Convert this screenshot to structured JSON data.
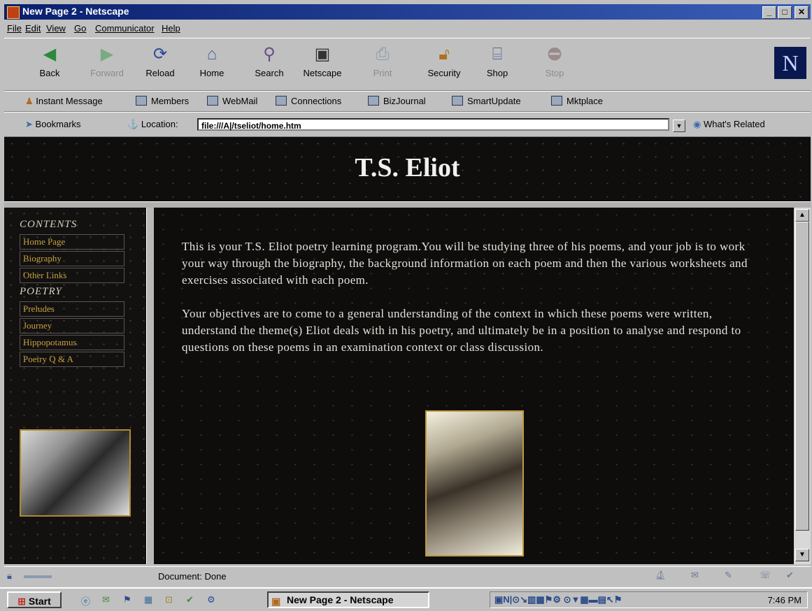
{
  "window": {
    "title": "New Page 2 - Netscape"
  },
  "menu": [
    "File",
    "Edit",
    "View",
    "Go",
    "Communicator",
    "Help"
  ],
  "nav_buttons": [
    {
      "label": "Back",
      "icon": "back-icon",
      "enabled": true
    },
    {
      "label": "Forward",
      "icon": "forward-icon",
      "enabled": false
    },
    {
      "label": "Reload",
      "icon": "reload-icon",
      "enabled": true
    },
    {
      "label": "Home",
      "icon": "home-icon",
      "enabled": true
    },
    {
      "label": "Search",
      "icon": "search-icon",
      "enabled": true
    },
    {
      "label": "Netscape",
      "icon": "netscape-icon",
      "enabled": true
    },
    {
      "label": "Print",
      "icon": "print-icon",
      "enabled": false
    },
    {
      "label": "Security",
      "icon": "lock-icon",
      "enabled": true
    },
    {
      "label": "Shop",
      "icon": "shop-icon",
      "enabled": true
    },
    {
      "label": "Stop",
      "icon": "stop-icon",
      "enabled": false
    }
  ],
  "personal_bar": [
    "Instant Message",
    "Members",
    "WebMail",
    "Connections",
    "BizJournal",
    "SmartUpdate",
    "Mktplace"
  ],
  "location": {
    "bookmarks_label": "Bookmarks",
    "location_label": "Location:",
    "url": "file:///A|/tseliot/home.htm",
    "related_label": "What's Related"
  },
  "page": {
    "title": "T.S. Eliot",
    "contents_heading": "CONTENTS",
    "contents_links": [
      "Home Page",
      "Biography",
      "Other Links"
    ],
    "poetry_heading": "POETRY",
    "poetry_links": [
      "Preludes",
      "Journey",
      "Hippopotamus",
      "Poetry Q & A"
    ],
    "paragraph1": "This is your T.S. Eliot poetry learning program.You will be studying three of his poems, and your job is to work your way through the biography, the background information on each poem and then the various worksheets and exercises associated with each poem.",
    "paragraph2": "Your objectives are to come to a general understanding of the context in which these poems were written, understand the theme(s) Eliot deals with in his poetry, and ultimately be in a position to analyse and respond to questions on these poems in an examination context or class discussion."
  },
  "status": {
    "text": "Document: Done"
  },
  "taskbar": {
    "start_label": "Start",
    "task_label": "New Page 2 - Netscape",
    "clock": "7:46 PM"
  },
  "colors": {
    "titlebar": "#0a1f6e",
    "page_background": "#0f0e0c",
    "link_color": "#c8a040",
    "text_color": "#e6e2da"
  }
}
